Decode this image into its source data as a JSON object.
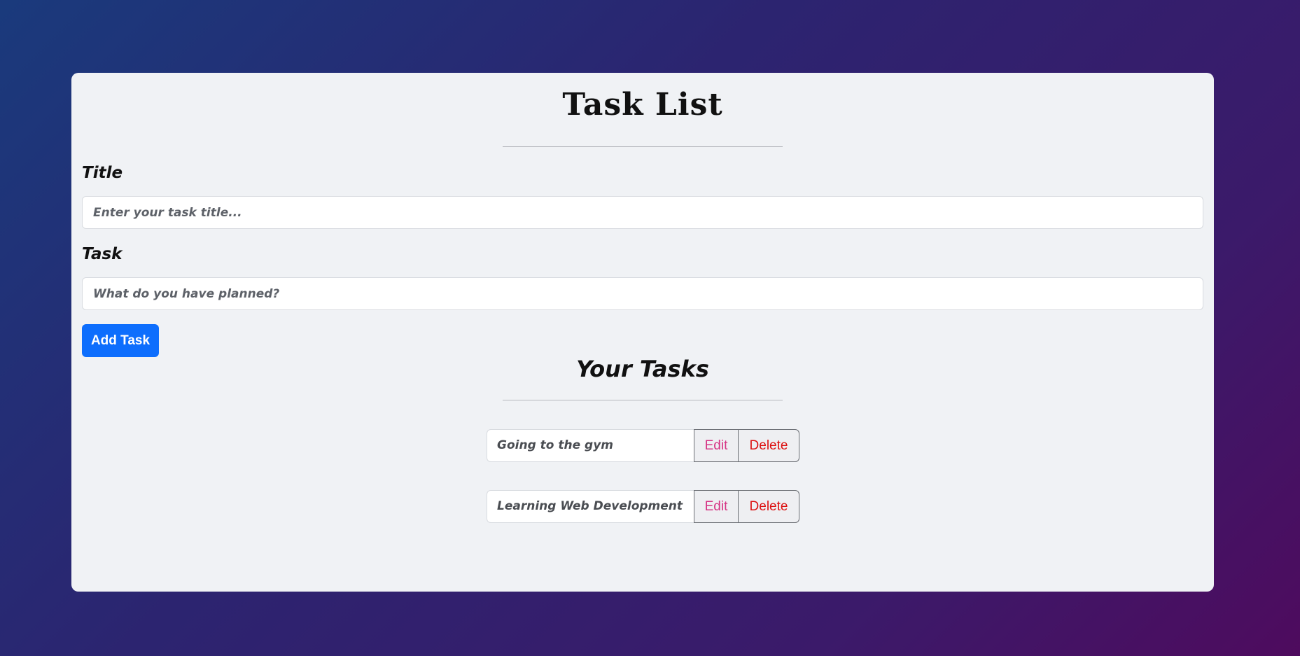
{
  "app": {
    "title": "Task List"
  },
  "form": {
    "title_label": "Title",
    "title_placeholder": "Enter your task title...",
    "title_value": "",
    "task_label": "Task",
    "task_placeholder": "What do you have planned?",
    "task_value": "",
    "add_button_label": "Add Task"
  },
  "tasks_section": {
    "heading": "Your Tasks",
    "items": [
      {
        "text": "Going to the gym",
        "edit_label": "Edit",
        "delete_label": "Delete"
      },
      {
        "text": "Learning Web Development",
        "edit_label": "Edit",
        "delete_label": "Delete"
      }
    ]
  },
  "colors": {
    "primary_button": "#0d6efd",
    "edit_text": "#d63384",
    "delete_text": "#dc1010",
    "card_background": "#f0f2f5"
  }
}
